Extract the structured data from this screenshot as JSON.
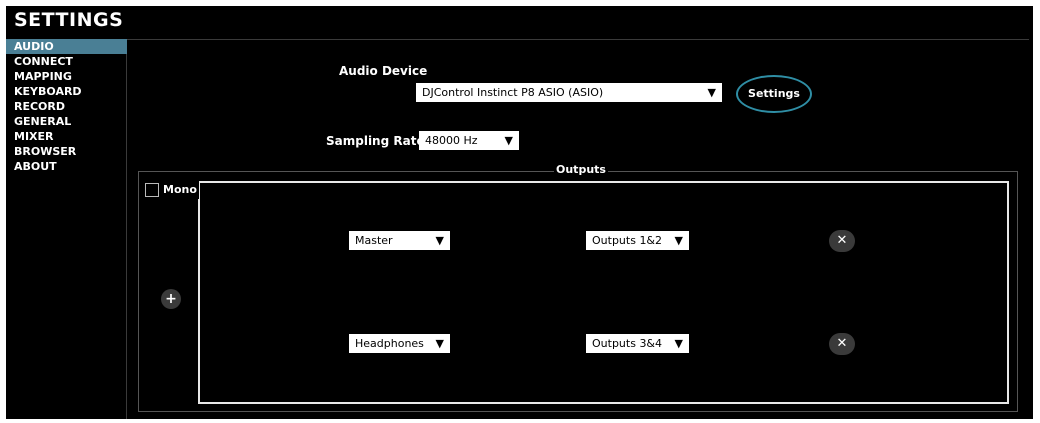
{
  "app": {
    "title": "SETTINGS"
  },
  "sidebar": {
    "items": [
      {
        "label": "AUDIO",
        "active": true
      },
      {
        "label": "CONNECT"
      },
      {
        "label": "MAPPING"
      },
      {
        "label": "KEYBOARD"
      },
      {
        "label": "RECORD"
      },
      {
        "label": "GENERAL"
      },
      {
        "label": "MIXER"
      },
      {
        "label": "BROWSER"
      },
      {
        "label": "ABOUT"
      }
    ]
  },
  "audio_device": {
    "label": "Audio Device",
    "selected": "DJControl Instinct P8 ASIO (ASIO)",
    "settings_button": "Settings"
  },
  "sampling_rate": {
    "label": "Sampling Rate:",
    "selected": "48000 Hz"
  },
  "outputs": {
    "legend": "Outputs",
    "mono_label": "Mono",
    "mono_checked": false,
    "rows": [
      {
        "channel": "Master",
        "output": "Outputs 1&2"
      },
      {
        "channel": "Headphones",
        "output": "Outputs 3&4"
      }
    ]
  },
  "icons": {
    "dropdown": "▼",
    "add": "+",
    "remove": "✕"
  },
  "colors": {
    "accent": "#4a7f95",
    "button_ring": "#2f8ea5",
    "background": "#000000"
  }
}
